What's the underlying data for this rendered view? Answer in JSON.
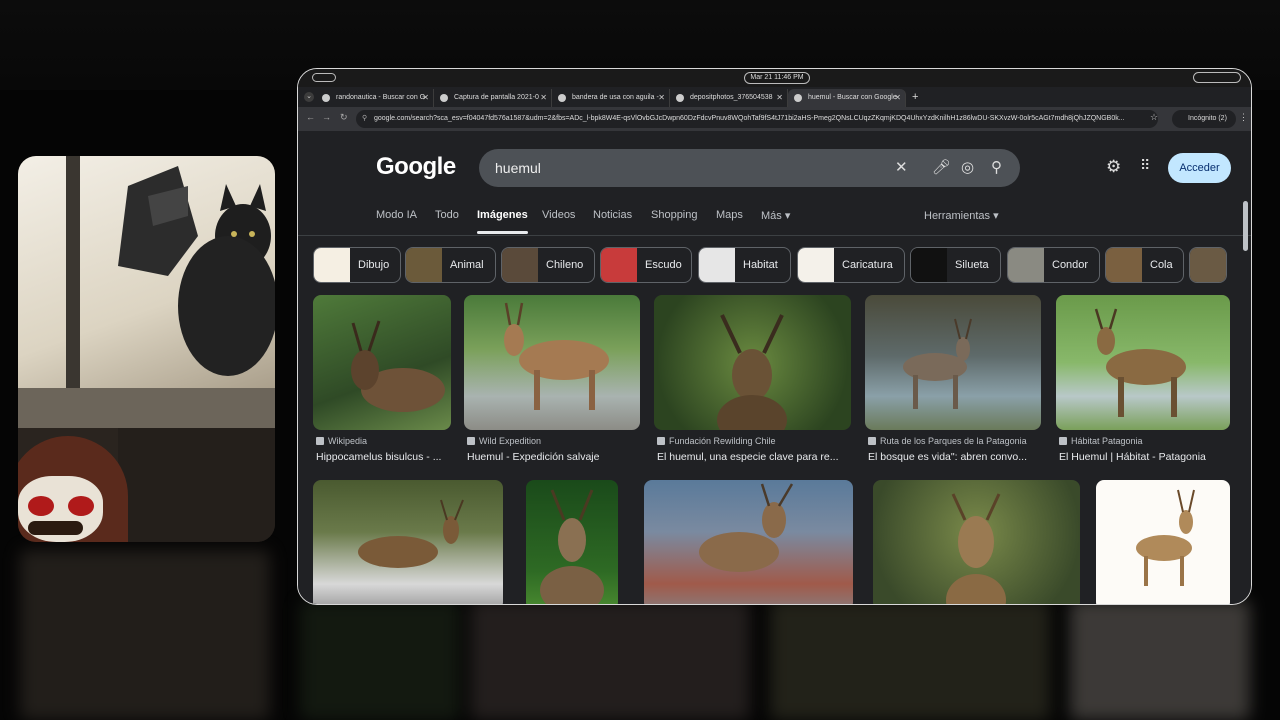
{
  "system_bar": {
    "clock": "Mar 21  11:46 PM"
  },
  "tabs": [
    {
      "label": "randonautica - Buscar con G",
      "active": false
    },
    {
      "label": "Captura de pantalla 2021-0",
      "active": false
    },
    {
      "label": "bandera de usa con aguila -",
      "active": false
    },
    {
      "label": "depositphotos_376504538",
      "active": false
    },
    {
      "label": "huemul - Buscar con Google",
      "active": true
    }
  ],
  "address_bar": {
    "url": "google.com/search?sca_esv=f04047fd576a1587&udm=2&fbs=ADc_l-bpk8W4E-qsVlOvbGJcDwpn60DzFdcvPnuv8WQohTaf9fS4tJ71bi2aHS-Pmeg2QNsLCUqzZKqmjKDQ4UhxYzdKnilhH1z86lwDU-SKXvzW-0olr5cAGt7mdh8jQhJZQNGB0k...",
    "incognito": "Incógnito (2)"
  },
  "google": {
    "logo": "Google",
    "query": "huemul",
    "signin": "Acceder",
    "nav_tabs": [
      "Modo IA",
      "Todo",
      "Imágenes",
      "Videos",
      "Noticias",
      "Shopping",
      "Maps",
      "Más ▾"
    ],
    "tools": "Herramientas ▾",
    "chips": [
      "Dibujo",
      "Animal",
      "Chileno",
      "Escudo",
      "Habitat",
      "Caricatura",
      "Silueta",
      "Condor",
      "Cola"
    ],
    "results_row1": [
      {
        "source": "Wikipedia",
        "title": "Hippocamelus bisulcus - ..."
      },
      {
        "source": "Wild Expedition",
        "title": "Huemul - Expedición salvaje"
      },
      {
        "source": "Fundación Rewilding Chile",
        "title": "El huemul, una especie clave para re..."
      },
      {
        "source": "Ruta de los Parques de la Patagonia",
        "title": "El bosque es vida\": abren convo..."
      },
      {
        "source": "Hábitat Patagonia",
        "title": "El Huemul | Hábitat - Patagonia"
      }
    ]
  },
  "colors": {
    "page_bg": "#202124",
    "signin_bg": "#c2e7ff",
    "search_bg": "#4d5156"
  }
}
